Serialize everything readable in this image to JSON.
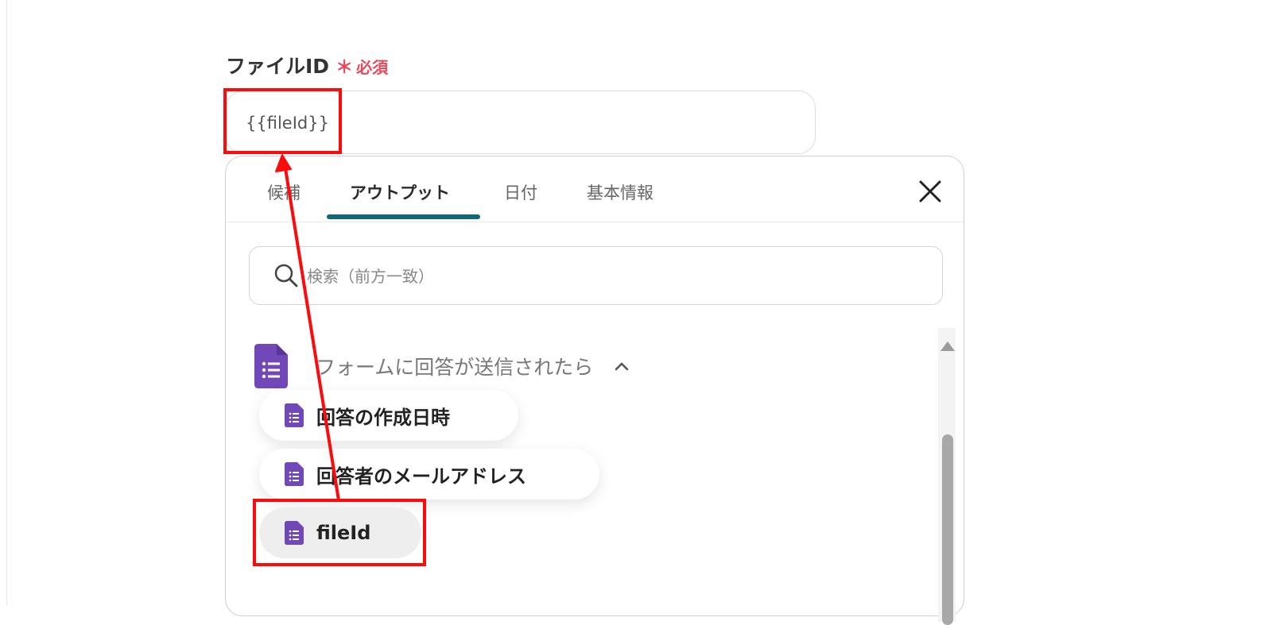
{
  "field": {
    "label": "ファイルID",
    "required_mark": "＊",
    "required_text": "必須",
    "value": "{{fileId}}"
  },
  "tabs": [
    {
      "label": "候補",
      "active": false
    },
    {
      "label": "アウトプット",
      "active": true
    },
    {
      "label": "日付",
      "active": false
    },
    {
      "label": "基本情報",
      "active": false
    }
  ],
  "search": {
    "placeholder": "検索（前方一致）",
    "icon": "search-icon"
  },
  "group": {
    "title": "フォームに回答が送信されたら",
    "icon": "google-forms-icon",
    "expanded": true,
    "items": [
      {
        "label": "回答の作成日時"
      },
      {
        "label": "回答者のメールアドレス"
      },
      {
        "label": "fileId",
        "selected": true
      }
    ]
  },
  "colors": {
    "accent": "#0f6777",
    "required": "#e8495a",
    "forms_purple": "#7248b9",
    "annotation_red": "#ff0a0a"
  }
}
